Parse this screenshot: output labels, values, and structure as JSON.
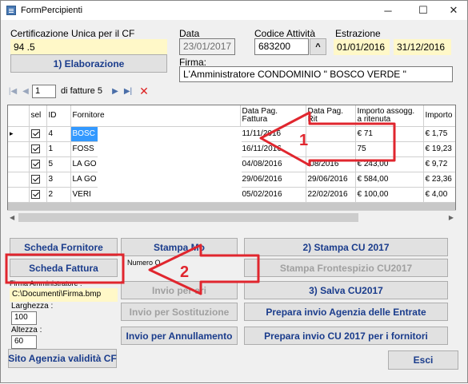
{
  "window": {
    "title": "FormPercipienti",
    "min": "─",
    "max": "☐",
    "close": "✕"
  },
  "header": {
    "cu_label": "Certificazione Unica per il CF",
    "cu_value": "94            .5",
    "data_label": "Data",
    "data_value": "23/01/2017",
    "codice_label": "Codice Attività",
    "codice_value": "683200",
    "estrazione_label": "Estrazione",
    "estrazione_from": "01/01/2016",
    "estrazione_to": "31/12/2016",
    "elaborazione_btn": "1) Elaborazione",
    "firma_label": "Firma:",
    "firma_value": "L'Amministratore CONDOMINIO \" BOSCO VERDE \""
  },
  "navigator": {
    "position": "1",
    "of_label": "di fatture 5"
  },
  "grid": {
    "columns": [
      "",
      "sel",
      "ID",
      "Fornitore",
      "Data Pag. Fattura",
      "Data Pag. Rit",
      "Importo assogg. a ritenuta",
      "Importo Rit"
    ],
    "rows": [
      {
        "sel": true,
        "id": "4",
        "fornitore": "BOSC",
        "data_fatt": "11/11/2016",
        "data_rit": "",
        "importo": "€ 71",
        "rit": "€ 1,75"
      },
      {
        "sel": true,
        "id": "1",
        "fornitore": "FOSS",
        "data_fatt": "16/11/2016",
        "data_rit": "",
        "importo": "75",
        "rit": "€ 19,23"
      },
      {
        "sel": true,
        "id": "5",
        "fornitore": "LA GO",
        "data_fatt": "04/08/2016",
        "data_rit": "/08/2016",
        "importo": "€ 243,00",
        "rit": "€ 9,72"
      },
      {
        "sel": true,
        "id": "3",
        "fornitore": "LA GO",
        "data_fatt": "29/06/2016",
        "data_rit": "29/06/2016",
        "importo": "€ 584,00",
        "rit": "€ 23,36"
      },
      {
        "sel": true,
        "id": "2",
        "fornitore": "VERI",
        "data_fatt": "05/02/2016",
        "data_rit": "22/02/2016",
        "importo": "€ 100,00",
        "rit": "€ 4,00"
      }
    ]
  },
  "buttons": {
    "scheda_fornitore": "Scheda Fornitore",
    "stampa": "Stampa Mo",
    "stampa_cu": "2) Stampa CU 2017",
    "scheda_fattura": "Scheda Fattura",
    "stampa_frontespizio": "Stampa Frontespizio CU2017",
    "invio_ordinari": "Invio per          ari",
    "salva_cu": "3) Salva CU2017",
    "invio_sostituzione": "Invio per Sostituzione",
    "prepara_agenzia": "Prepara  invio Agenzia delle Entrate",
    "invio_annullamento": "Invio per Annullamento",
    "prepara_fornitori": "Prepara invio CU 2017 per i fornitori",
    "sito_agenzia": "Sito Agenzia validità CF",
    "esci": "Esci"
  },
  "side": {
    "numero_label": "Numero O",
    "firma_amm_label": "Firma Amministratore :",
    "firma_amm_path": "C:\\Documenti\\Firma.bmp",
    "larghezza_label": "Larghezza :",
    "larghezza_value": "100",
    "altezza_label": "Altezza :",
    "altezza_value": "60"
  },
  "annotations": {
    "arrow1": "1",
    "arrow2": "2",
    "arrow_color": "#e0262e"
  }
}
